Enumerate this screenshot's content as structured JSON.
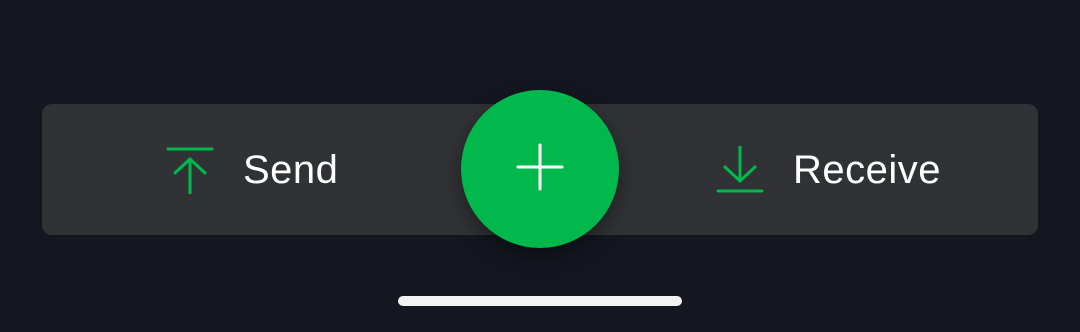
{
  "colors": {
    "background": "#141720",
    "bar": "#313235",
    "accent": "#00b84b",
    "label": "#ffffff",
    "home_indicator": "#f3f3f3"
  },
  "actions": {
    "send": {
      "label": "Send",
      "icon": "upload-arrow-icon"
    },
    "receive": {
      "label": "Receive",
      "icon": "download-arrow-icon"
    }
  },
  "fab": {
    "icon": "plus-icon"
  }
}
